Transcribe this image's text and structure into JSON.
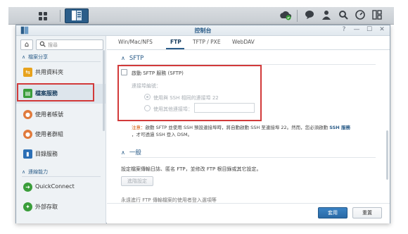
{
  "taskbar": {
    "icons": [
      "apps-grid-icon",
      "control-panel-icon",
      "cloud-sync-icon",
      "chat-icon",
      "user-icon",
      "search-icon",
      "dashboard-icon",
      "widgets-icon"
    ]
  },
  "window": {
    "title": "控制台",
    "controls": [
      "?",
      "—",
      "☐",
      "✕"
    ]
  },
  "sidebar": {
    "search_placeholder": "搜尋",
    "section_file_sharing": "檔案分享",
    "section_connectivity": "連線能力",
    "items": [
      {
        "label": "共用資料夾",
        "color": "#e7a21c",
        "icon": "shared-folder-icon"
      },
      {
        "label": "檔案服務",
        "color": "#3a9d3a",
        "icon": "file-services-icon",
        "selected": true
      },
      {
        "label": "使用者帳號",
        "color": "#e07a3c",
        "icon": "user-account-icon"
      },
      {
        "label": "使用者群組",
        "color": "#e07a3c",
        "icon": "user-group-icon"
      },
      {
        "label": "目錄服務",
        "color": "#2b6fb5",
        "icon": "directory-icon"
      },
      {
        "label": "QuickConnect",
        "color": "#3a9d3a",
        "icon": "quickconnect-icon"
      },
      {
        "label": "外部存取",
        "color": "#3a9d3a",
        "icon": "external-access-icon"
      }
    ]
  },
  "tabs": [
    {
      "label": "Win/Mac/NFS",
      "active": false
    },
    {
      "label": "FTP",
      "active": true
    },
    {
      "label": "TFTP / PXE",
      "active": false
    },
    {
      "label": "WebDAV",
      "active": false
    }
  ],
  "sftp": {
    "heading": "SFTP",
    "enable_label": "啟動 SFTP 服務 (SFTP)",
    "port_label": "連接埠編號：",
    "same_as_ssh": "使用與 SSH 相同的連接埠 22",
    "other_port": "使用其他連接埠：",
    "port_value": "",
    "note_prefix": "注意：",
    "note_line1": "啟動 SFTP 並使用 SSH 預設連接埠時，將自動啟動 SSH 至連接埠 22。然而，您必須啟動",
    "note_link": "SSH 服務",
    "note_line2": "，才可透過 SSH 登入 DSM。"
  },
  "general": {
    "heading": "一般",
    "description": "設定檔案傳輸日誌、匿名 FTP，並修改 FTP 根目錄或其它設定。",
    "advanced_button": "進階設定",
    "cut_text": "永遠進行 FTP 傳輸檔案的使用者登入選項等"
  },
  "footer": {
    "apply": "套用",
    "reset": "重置"
  }
}
